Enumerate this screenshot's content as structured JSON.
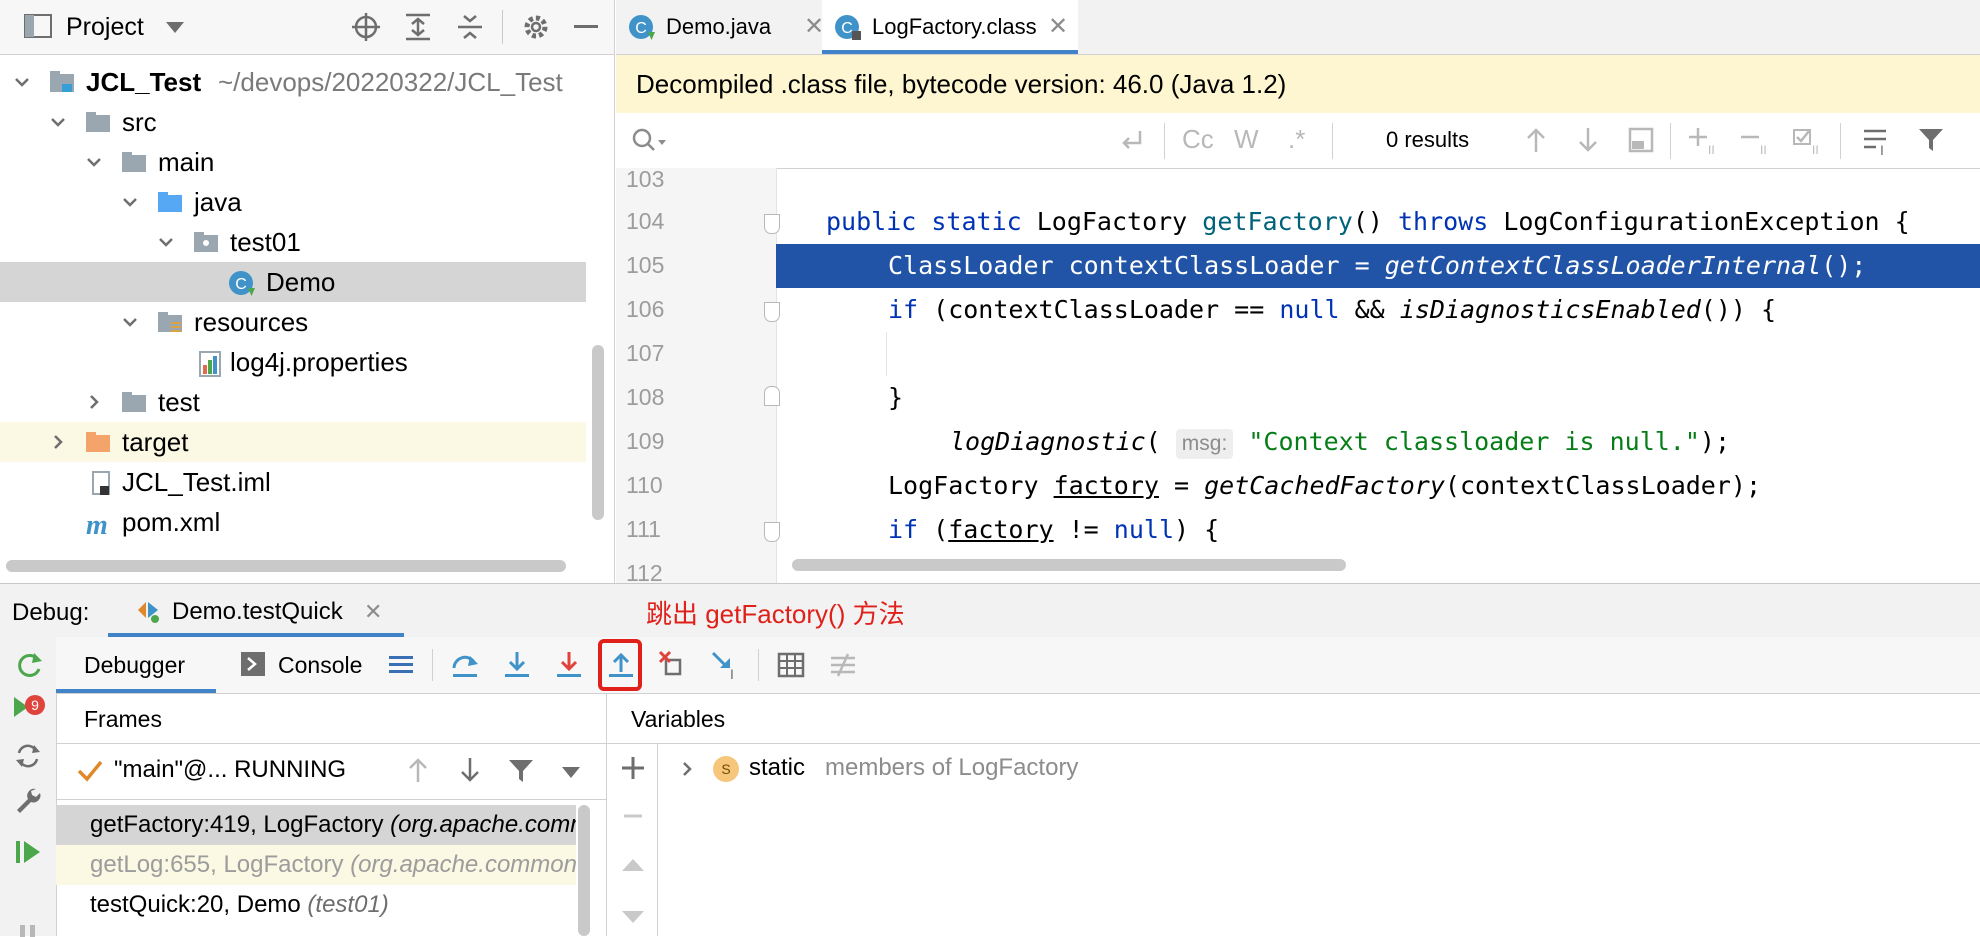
{
  "project": {
    "title": "Project",
    "tree": [
      {
        "label": "JCL_Test",
        "suffix": "~/devops/20220322/JCL_Test",
        "kind": "module"
      },
      {
        "label": "src",
        "kind": "folder"
      },
      {
        "label": "main",
        "kind": "folder"
      },
      {
        "label": "java",
        "kind": "source-folder"
      },
      {
        "label": "test01",
        "kind": "package"
      },
      {
        "label": "Demo",
        "kind": "class"
      },
      {
        "label": "resources",
        "kind": "resources-folder"
      },
      {
        "label": "log4j.properties",
        "kind": "properties-file"
      },
      {
        "label": "test",
        "kind": "folder"
      },
      {
        "label": "target",
        "kind": "excluded-folder"
      },
      {
        "label": "JCL_Test.iml",
        "kind": "iml-file"
      },
      {
        "label": "pom.xml",
        "kind": "maven-file"
      }
    ]
  },
  "editor": {
    "tabs": [
      {
        "label": "Demo.java",
        "active": false
      },
      {
        "label": "LogFactory.class",
        "active": true
      }
    ],
    "banner": "Decompiled .class file, bytecode version: 46.0 (Java 1.2)",
    "search": {
      "placeholder": "",
      "results": "0 results",
      "case_label": "Cc",
      "words_label": "W",
      "regex_label": ".*"
    },
    "line_numbers": [
      "103",
      "104",
      "105",
      "106",
      "107",
      "108",
      "109",
      "110",
      "111",
      "112"
    ],
    "code": {
      "l104": {
        "a": "public static ",
        "b": "LogFactory ",
        "c": "getFactory",
        "d": "() ",
        "e": "throws ",
        "f": "LogConfigurationException {"
      },
      "l105": {
        "a": "ClassLoader contextClassLoader = ",
        "b": "getContextClassLoaderInternal",
        "c": "();"
      },
      "l106": {
        "a": "if ",
        "b": "(contextClassLoader == ",
        "c": "null ",
        "d": "&& ",
        "e": "isDiagnosticsEnabled",
        "f": "()) {"
      },
      "l107": {
        "a": "logDiagnostic",
        "b": "( ",
        "hint": "msg:",
        "c": "\"Context classloader is null.\"",
        "d": ");"
      },
      "l108": {
        "a": "}"
      },
      "l110": {
        "a": "LogFactory ",
        "b": "factory",
        "c": " = ",
        "d": "getCachedFactory",
        "e": "(contextClassLoader);"
      },
      "l111": {
        "a": "if ",
        "b": "(",
        "c": "factory",
        "d": " != ",
        "e": "null",
        "f": ") {"
      }
    }
  },
  "debug": {
    "label": "Debug:",
    "session_tab": "Demo.testQuick",
    "tabs": {
      "debugger": "Debugger",
      "console": "Console"
    },
    "annotation": "跳出 getFactory() 方法",
    "frames": {
      "header": "Frames",
      "thread": "\"main\"@... RUNNING",
      "items": [
        {
          "method": "getFactory:419, LogFactory",
          "pkg": "(org.apache.commons.logging)",
          "selected": true
        },
        {
          "method": "getLog:655, LogFactory",
          "pkg": "(org.apache.commons.logging)",
          "dim": true
        },
        {
          "method": "testQuick:20, Demo",
          "pkg": "(test01)"
        }
      ]
    },
    "variables": {
      "header": "Variables",
      "items": [
        {
          "badge": "S",
          "keyword": "static",
          "text": "members of LogFactory"
        }
      ]
    }
  }
}
